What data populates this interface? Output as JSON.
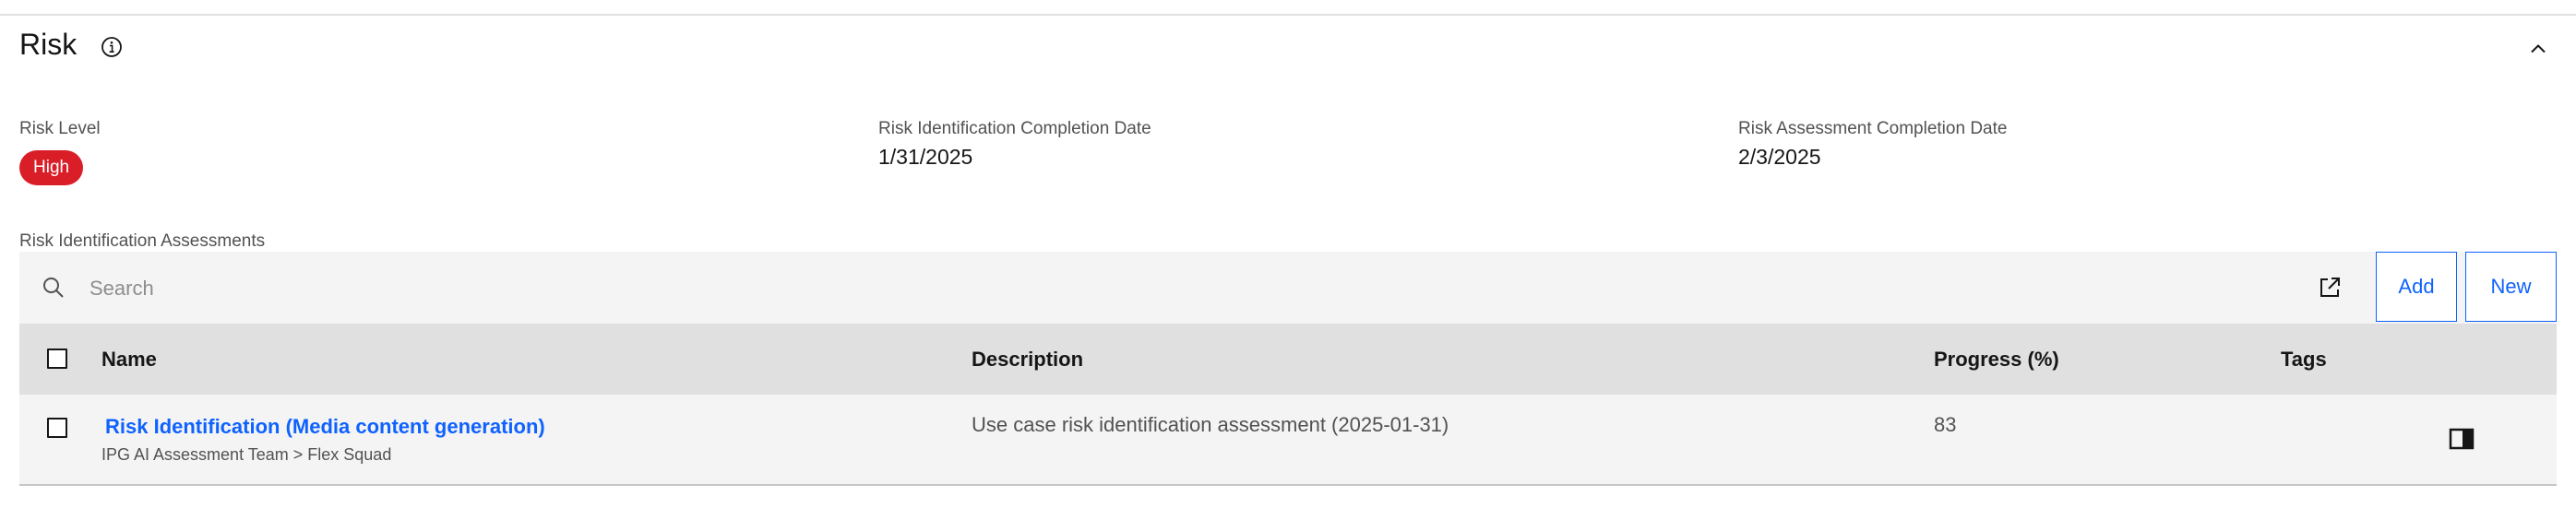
{
  "section": {
    "title": "Risk"
  },
  "fields": {
    "risk_level": {
      "label": "Risk Level",
      "value": "High"
    },
    "identification_date": {
      "label": "Risk Identification Completion Date",
      "value": "1/31/2025"
    },
    "assessment_date": {
      "label": "Risk Assessment Completion Date",
      "value": "2/3/2025"
    }
  },
  "table": {
    "label": "Risk Identification Assessments",
    "search_placeholder": "Search",
    "add_label": "Add",
    "new_label": "New",
    "columns": {
      "name": "Name",
      "description": "Description",
      "progress": "Progress (%)",
      "tags": "Tags"
    },
    "rows": [
      {
        "name": "Risk Identification (Media content generation)",
        "owner": "IPG AI Assessment Team > Flex Squad",
        "description": "Use case risk identification assessment (2025-01-31)",
        "progress": "83",
        "tags": ""
      }
    ]
  },
  "colors": {
    "accent": "#0f62fe",
    "badge_high": "#da1e28",
    "toolbar_bg": "#f4f4f4",
    "header_bg": "#e0e0e0"
  },
  "icons": {
    "info": "info-icon",
    "collapse": "chevron-up-icon",
    "search": "search-icon",
    "export": "launch-icon",
    "panel": "side-panel-icon"
  }
}
